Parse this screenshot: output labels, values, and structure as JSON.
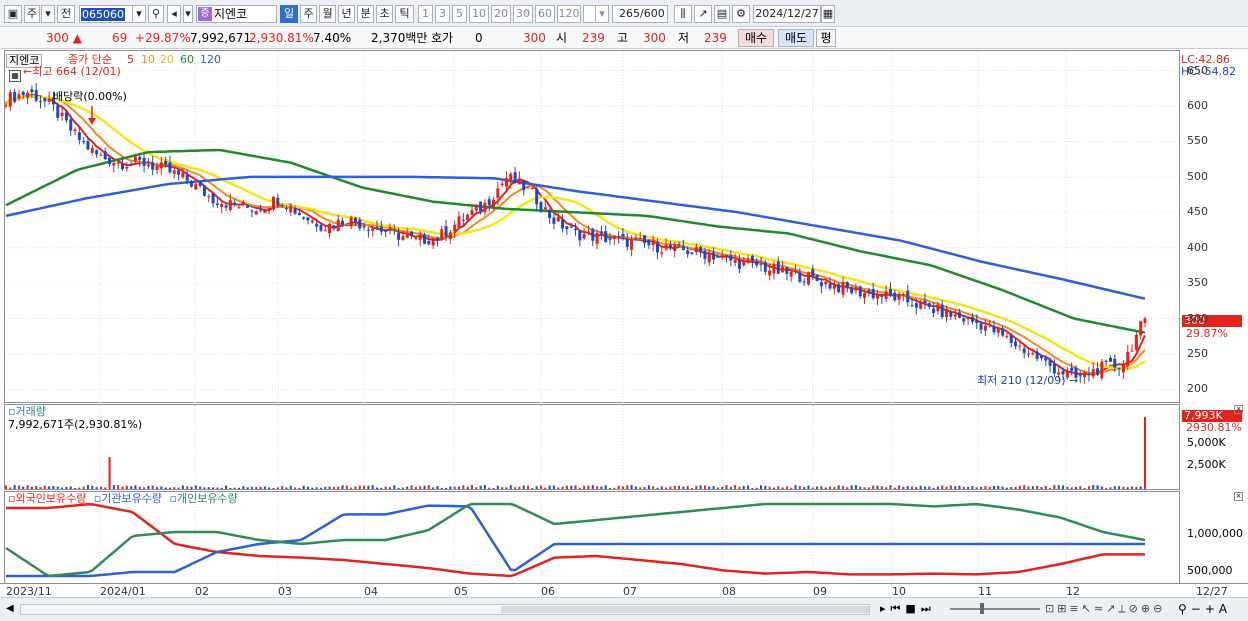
{
  "toolbar": {
    "period_week": "주",
    "prev_label": "전",
    "stock_code": "065060",
    "stock_name": "지엔코",
    "stock_badge": "증",
    "tabs": [
      "일",
      "주",
      "월",
      "년",
      "분",
      "초",
      "틱"
    ],
    "intervals": [
      "1",
      "3",
      "5",
      "10",
      "20",
      "30",
      "60",
      "120"
    ],
    "count": "265",
    "count_total": "/600",
    "date": "2024/12/27"
  },
  "info": {
    "price": "300",
    "change": "69",
    "change_pct": "+29.87%",
    "volume": "7,992,671",
    "volume_pct": "2,930.81%",
    "turnover": "7.40%",
    "amount": "2,370백만",
    "quote_label": "호가",
    "quote_value": "0",
    "quote_price": "300",
    "open_label": "시",
    "open_value": "239",
    "high_label": "고",
    "high_value": "300",
    "low_label": "저",
    "low_value": "239",
    "buy_label": "매수",
    "sell_label": "매도",
    "eval_label": "평"
  },
  "price_panel": {
    "stock_label": "지엔코",
    "ma_title": "종가 단순",
    "ma_periods": [
      "5",
      "10",
      "20",
      "60",
      "120"
    ],
    "ma_colors": [
      "#e0231b",
      "#f08a1c",
      "#f5e31a",
      "#1f8a2a",
      "#2d5fd9"
    ],
    "high_annotation": "최고 664 (12/01)",
    "dividend_annotation": "배당락(0.00%)",
    "low_annotation": "최저 210 (12/09)",
    "lc_label": "LC:42.86",
    "hc_label": "HC:-54.82",
    "last_price_tag": "300",
    "last_pct": "29.87%",
    "y_ticks": [
      "650",
      "600",
      "550",
      "500",
      "450",
      "400",
      "350",
      "300",
      "250",
      "200"
    ]
  },
  "volume_panel": {
    "title": "거래량",
    "summary": "7,992,671주(2,930.81%)",
    "last_tag": "7,993K",
    "last_pct": "2930.81%",
    "y_ticks": [
      "5,000K",
      "2,500K"
    ]
  },
  "holding_panel": {
    "foreign": "외국인보유수량",
    "institution": "기관보유수량",
    "individual": "개인보유수량",
    "y_ticks": [
      "1,000,000",
      "500,000"
    ]
  },
  "x_axis": [
    "2023/11",
    "2024/01",
    "02",
    "03",
    "04",
    "05",
    "06",
    "07",
    "08",
    "09",
    "10",
    "11",
    "12",
    "12/27"
  ],
  "chart_data": {
    "type": "line",
    "title": "지엔코",
    "series": [
      {
        "name": "5",
        "color": "#e0231b"
      },
      {
        "name": "10",
        "color": "#f08a1c"
      },
      {
        "name": "20",
        "color": "#f5e31a"
      },
      {
        "name": "60",
        "color": "#1f8a2a"
      },
      {
        "name": "120",
        "color": "#2d5fd9"
      }
    ],
    "ylim": [
      185,
      665
    ],
    "close_approx": [
      610,
      620,
      600,
      560,
      530,
      520,
      520,
      510,
      495,
      470,
      460,
      455,
      470,
      445,
      430,
      440,
      430,
      420,
      410,
      415,
      440,
      460,
      500,
      480,
      440,
      420,
      415,
      410,
      405,
      400,
      395,
      390,
      380,
      375,
      365,
      360,
      350,
      340,
      335,
      330,
      320,
      310,
      300,
      290,
      270,
      250,
      230,
      215,
      230,
      235,
      300
    ],
    "ma120_approx": [
      445,
      470,
      490,
      500,
      500,
      500,
      498,
      480,
      465,
      450,
      430,
      410,
      380,
      355,
      328
    ],
    "ma60_approx": [
      460,
      510,
      535,
      538,
      520,
      485,
      465,
      455,
      450,
      445,
      430,
      420,
      395,
      375,
      340,
      300,
      280
    ]
  }
}
